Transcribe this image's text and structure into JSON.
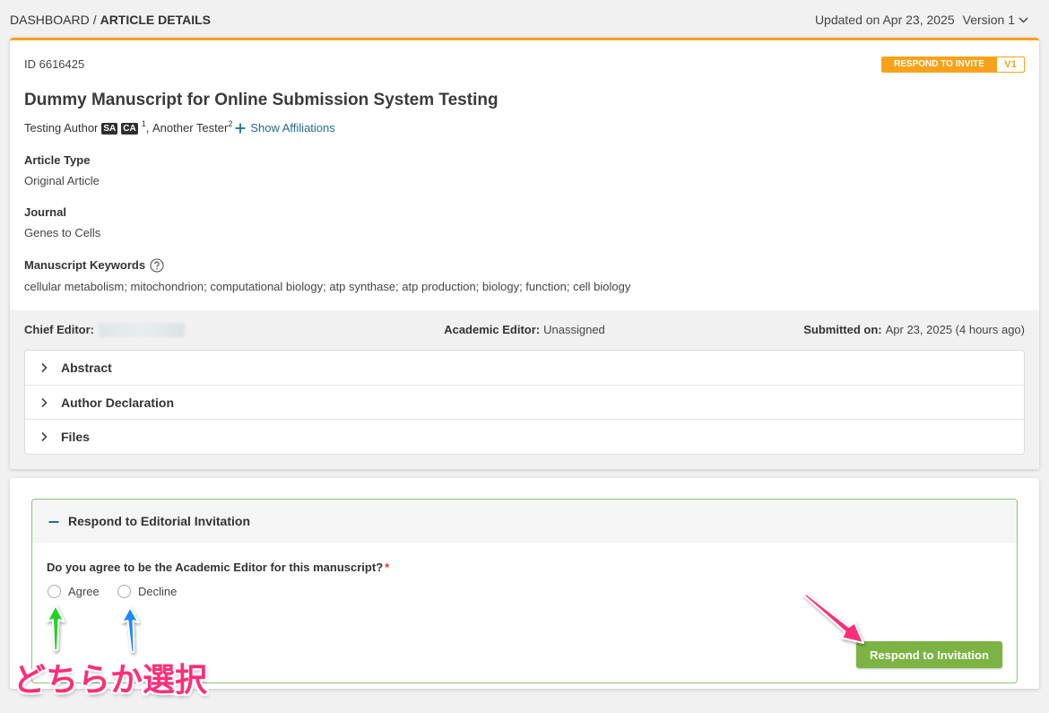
{
  "breadcrumb": {
    "parent": "DASHBOARD",
    "separator": "/",
    "current": "ARTICLE DETAILS"
  },
  "header_meta": {
    "updated": "Updated on Apr 23, 2025",
    "version": "Version 1"
  },
  "article": {
    "id": "ID 6616425",
    "status_badge": "RESPOND TO INVITE",
    "version_badge": "V1",
    "title": "Dummy Manuscript for Online Submission System Testing",
    "authors": [
      {
        "name": "Testing Author",
        "roles": [
          "SA",
          "CA"
        ],
        "affiliation": "1"
      },
      {
        "name": "Another Tester",
        "affiliation": "2"
      }
    ],
    "author_separator": ", ",
    "show_affiliations": "Show Affiliations",
    "fields": {
      "article_type": {
        "label": "Article Type",
        "value": "Original Article"
      },
      "journal": {
        "label": "Journal",
        "value": "Genes to Cells"
      },
      "keywords": {
        "label": "Manuscript Keywords",
        "value": "cellular metabolism; mitochondrion; computational biology; atp synthase; atp production; biology; function; cell biology"
      }
    }
  },
  "editors": {
    "chief": {
      "label": "Chief Editor:"
    },
    "academic": {
      "label": "Academic Editor:",
      "value": "Unassigned"
    },
    "submitted": {
      "label": "Submitted on:",
      "value": "Apr 23, 2025 (4 hours ago)"
    }
  },
  "accordion": [
    {
      "label": "Abstract",
      "expanded": false
    },
    {
      "label": "Author Declaration",
      "expanded": false
    },
    {
      "label": "Files",
      "expanded": false
    }
  ],
  "invitation": {
    "title": "Respond to Editorial Invitation",
    "expanded": true,
    "question": "Do you agree to be the Academic Editor for this manuscript?",
    "required_mark": "*",
    "options": [
      {
        "label": "Agree",
        "selected": false
      },
      {
        "label": "Decline",
        "selected": false
      }
    ],
    "submit_label": "Respond to Invitation"
  },
  "annotation": {
    "text": "どちらか選択"
  },
  "icons": {
    "version_dropdown": "chevron-down-icon",
    "show_affiliations": "plus-icon",
    "keywords_help": "help-circle-icon",
    "accordion_toggle": "chevron-right-icon",
    "invitation_toggle": "minus-icon"
  },
  "colors": {
    "accent": "#f7a21b",
    "link": "#1d6f8a",
    "green": "#7cb342",
    "green-border": "#8cc56b",
    "required": "#e53935",
    "band": "#f1f1f1",
    "arrow-green": "#22d422",
    "arrow-blue": "#1e88ff",
    "arrow-pink": "#ff2d7a",
    "annot-text": "#ff2d7a"
  }
}
